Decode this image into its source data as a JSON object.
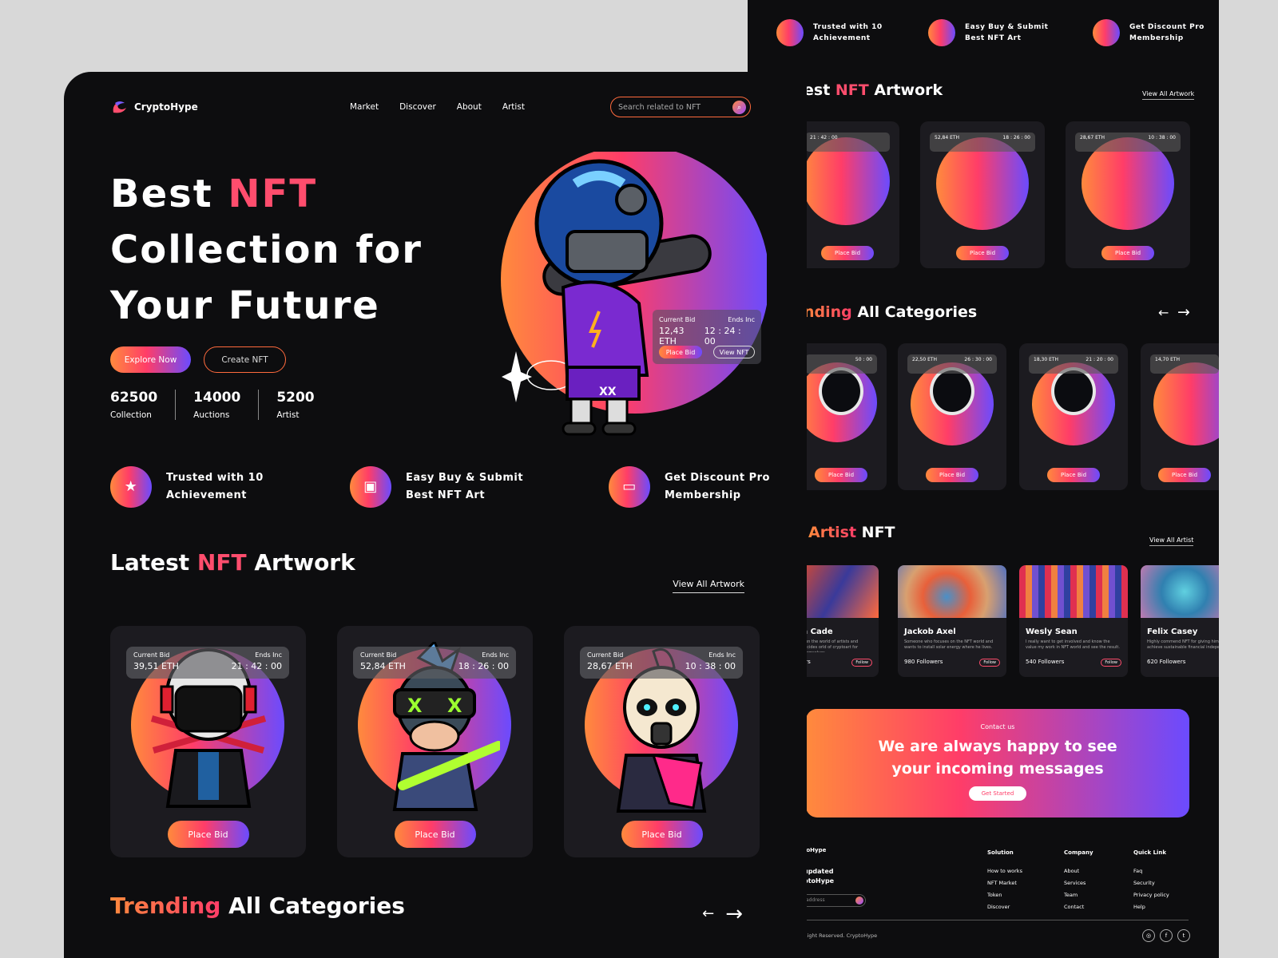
{
  "colors": {
    "accent_orange": "#ff8a3d",
    "accent_pink": "#ff3d68",
    "accent_purple": "#6b4bff",
    "bg": "#0d0d0f",
    "card": "#1c1b20"
  },
  "brand": "CryptoHype",
  "nav": {
    "items": [
      "Market",
      "Discover",
      "About",
      "Artist"
    ],
    "search_placeholder": "Search related to NFT"
  },
  "hero": {
    "line1a": "Best ",
    "line1b": "NFT",
    "line2": "Collection for",
    "line3": "Your Future",
    "explore": "Explore Now",
    "create": "Create NFT"
  },
  "stats": [
    {
      "value": "62500",
      "label": "Collection"
    },
    {
      "value": "14000",
      "label": "Auctions"
    },
    {
      "value": "5200",
      "label": "Artist"
    }
  ],
  "hero_bid": {
    "current": "Current Bid",
    "ends": "Ends Inc",
    "eth": "12,43 ETH",
    "time": "12 : 24 : 00",
    "place": "Place Bid",
    "view": "View NFT"
  },
  "features": [
    {
      "l1": "Trusted with 10",
      "l2": "Achievement",
      "icon": "ribbon-star-icon"
    },
    {
      "l1": "Easy Buy & Submit",
      "l2": "Best NFT Art",
      "icon": "shopping-bag-icon"
    },
    {
      "l1": "Get Discount Pro",
      "l2": "Membership",
      "icon": "card-icon"
    }
  ],
  "latest": {
    "a": "Latest ",
    "b": "NFT",
    "c": " Artwork",
    "view_all": "View All Artwork",
    "back_a": "est ",
    "back_b": "NFT",
    "back_c": " Artwork"
  },
  "cards": [
    {
      "cb": "Current Bid",
      "ends": "Ends Inc",
      "eth": "39,51 ETH",
      "time": "21 : 42 : 00",
      "btn": "Place Bid"
    },
    {
      "cb": "Current Bid",
      "ends": "Ends Inc",
      "eth": "52,84 ETH",
      "time": "18 : 26 : 00",
      "btn": "Place Bid"
    },
    {
      "cb": "Current Bid",
      "ends": "Ends Inc",
      "eth": "28,67 ETH",
      "time": "10 : 38 : 00",
      "btn": "Place Bid"
    }
  ],
  "trending": {
    "a": "Trending",
    "b": " All Categories",
    "back_a": "nding",
    "back_b": " All Categories"
  },
  "trend_cards": [
    {
      "eth": "",
      "time": "50 : 00",
      "btn": "Place Bid"
    },
    {
      "eth": "22,50 ETH",
      "time": "26 : 30 : 00",
      "btn": "Place Bid"
    },
    {
      "eth": "18,30 ETH",
      "time": "21 : 20 : 00",
      "btn": "Place Bid"
    },
    {
      "eth": "14,70 ETH",
      "time": "",
      "btn": "Place Bid"
    }
  ],
  "artists_title": {
    "a": "Artist",
    "b": " NFT",
    "view_all": "View All Artist"
  },
  "artists": [
    {
      "name": "n Cade",
      "desc": "s on the world of artists and decides orld of cryptoart for themselves",
      "followers": "ers",
      "follow": "Follow"
    },
    {
      "name": "Jackob Axel",
      "desc": "Someone who focuses on the NFT world and wants to install solar energy where he lives.",
      "followers": "980 Followers",
      "follow": "Follow"
    },
    {
      "name": "Wesly Sean",
      "desc": "I really want to get involved and know the value my work in NFT world and see the result.",
      "followers": "540 Followers",
      "follow": "Follow"
    },
    {
      "name": "Felix Casey",
      "desc": "Highly commend NFT for giving him achieve sustainable financial indepe",
      "followers": "620 Followers",
      "follow": ""
    }
  ],
  "contact": {
    "small": "Contact us",
    "l1": "We are always happy to see",
    "l2": "your incoming messages",
    "btn": "Get Started"
  },
  "footer": {
    "brand": "toHype",
    "news1": "updated",
    "news2": "ptoHype",
    "email": "address",
    "solution": {
      "title": "Solution",
      "items": [
        "How to works",
        "NFT Market",
        "Token",
        "Discover"
      ]
    },
    "company": {
      "title": "Company",
      "items": [
        "About",
        "Services",
        "Team",
        "Contact"
      ]
    },
    "quick": {
      "title": "Quick Link",
      "items": [
        "Faq",
        "Security",
        "Privacy policy",
        "Help"
      ]
    },
    "copy": "Right Reserved. CryptoHype"
  }
}
